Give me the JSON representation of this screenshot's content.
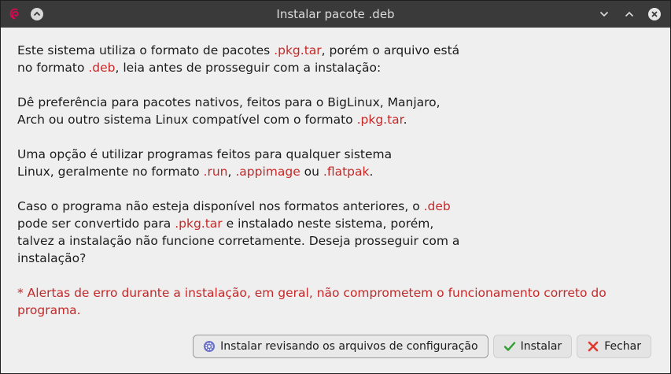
{
  "window": {
    "title": "Instalar pacote .deb",
    "icons": [
      "debian-logo-icon",
      "keep-above-icon",
      "minimize-icon",
      "maximize-icon",
      "close-icon"
    ]
  },
  "message": {
    "p1": {
      "t1": "Este sistema utiliza o formato de pacotes ",
      "h1": ".pkg.tar",
      "t2": ", porém o arquivo está",
      "t3": "no formato ",
      "h2": ".deb",
      "t4": ", leia antes de prosseguir com a instalação:"
    },
    "p2": {
      "t1": "Dê preferência para pacotes nativos, feitos para o BigLinux, Manjaro,",
      "t2": "Arch ou outro sistema Linux compatível com o formato ",
      "h1": ".pkg.tar",
      "t3": "."
    },
    "p3": {
      "t1": "Uma opção é utilizar programas feitos para qualquer sistema",
      "t2": "Linux, geralmente no formato ",
      "h1": ".run",
      "t3": ", ",
      "h2": ".appimage",
      "t4": " ou ",
      "h3": ".flatpak",
      "t5": "."
    },
    "p4": {
      "t1": "Caso o programa não esteja disponível nos formatos anteriores, o ",
      "h1": ".deb",
      "t2": "pode ser convertido para ",
      "h2": ".pkg.tar",
      "t3": " e instalado neste sistema, porém,",
      "t4": "talvez a instalação não funcione corretamente. Deseja prosseguir com a",
      "t5": "instalação?"
    },
    "warning": "* Alertas de erro durante a instalação, em geral, não comprometem o funcionamento correto do programa."
  },
  "buttons": {
    "review": "Instalar revisando os arquivos de configuração",
    "install": "Instalar",
    "close": "Fechar"
  },
  "colors": {
    "highlight": "#c62828",
    "titlebar": "#3a3a3a",
    "background": "#efefef"
  }
}
